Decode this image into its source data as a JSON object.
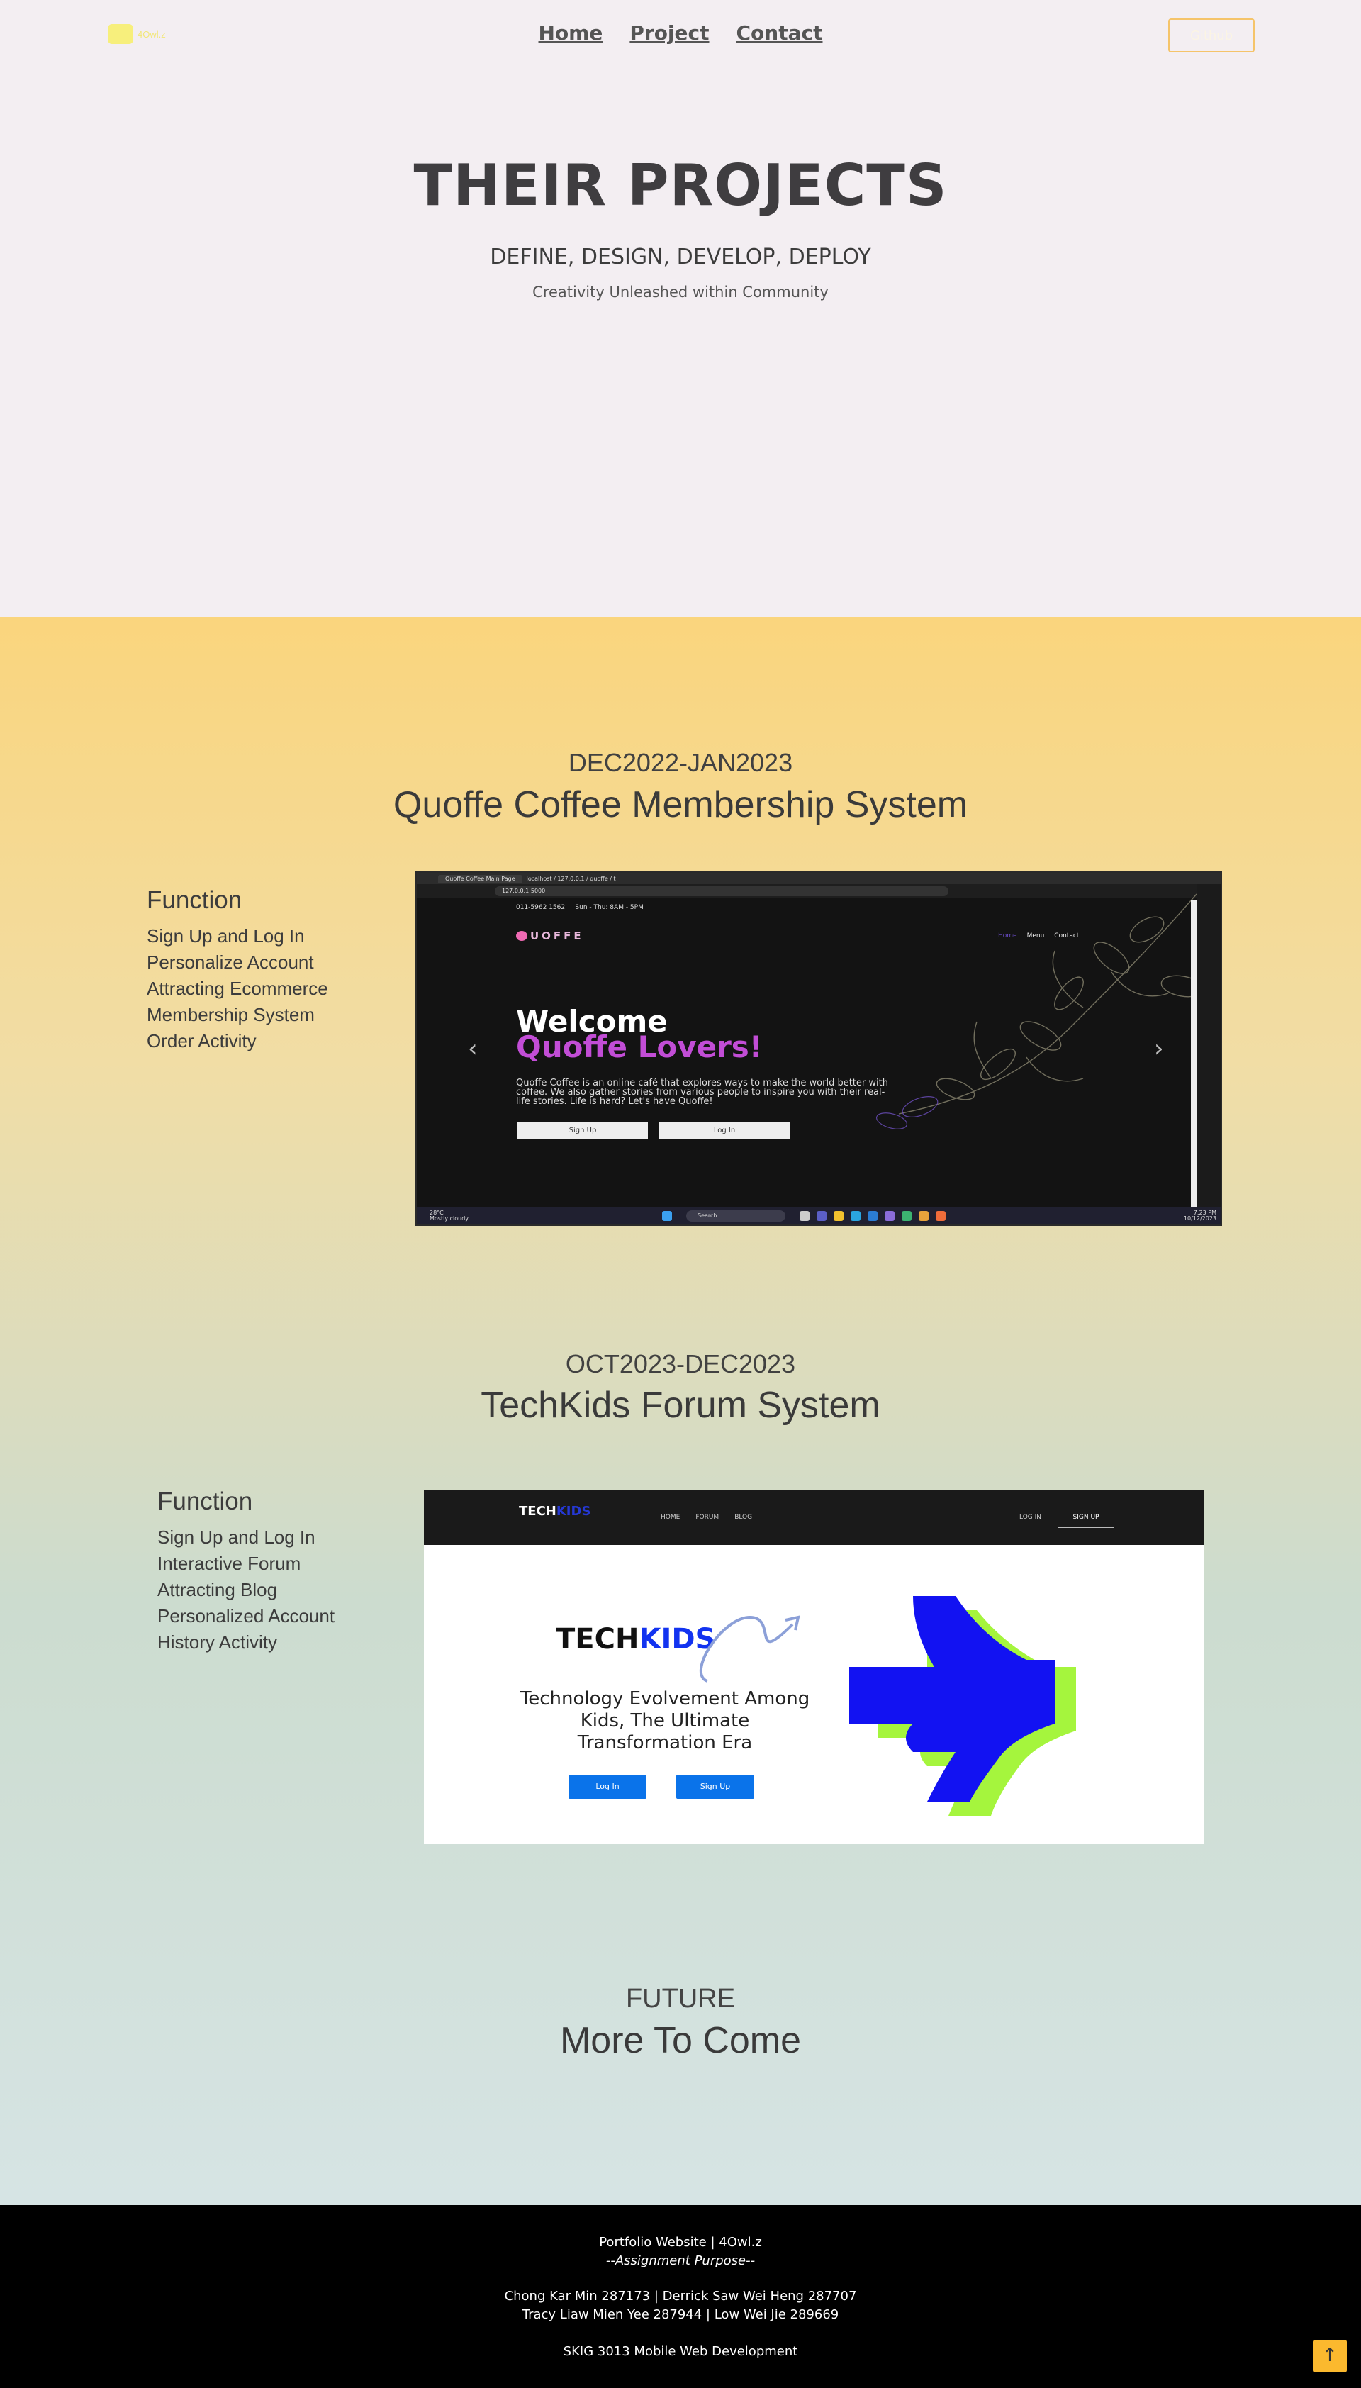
{
  "nav": {
    "logo_text": "4Owl.z",
    "links": [
      "Home",
      "Project",
      "Contact"
    ],
    "github_label": "Github"
  },
  "hero": {
    "title": "THEIR PROJECTS",
    "subtitle": "DEFINE, DESIGN, DEVELOP, DEPLOY",
    "tagline": "Creativity Unleashed within Community"
  },
  "projects": [
    {
      "date": "DEC2022-JAN2023",
      "title": "Quoffe Coffee Membership System",
      "function_heading": "Function",
      "functions": [
        "Sign Up and Log In",
        "Personalize Account",
        "Attracting Ecommerce",
        "Membership System",
        "Order Activity"
      ],
      "screenshot": {
        "tab1": "Quoffe Coffee Main Page",
        "tab2": "localhost / 127.0.0.1 / quoffe / t",
        "address": "127.0.0.1:5000",
        "phone": "011-5962 1562",
        "hours": "Sun - Thu: 8AM - 5PM",
        "logo": "UOFFE",
        "nav": [
          "Home",
          "Menu",
          "Contact"
        ],
        "welcome": "Welcome",
        "lovers": "Quoffe Lovers!",
        "description": "Quoffe Coffee is an online café that explores ways to make the world better with coffee. We also gather stories from various people to inspire you with their real-life stories. Life is hard? Let's have Quoffe!",
        "signup": "Sign Up",
        "login": "Log In",
        "weather_temp": "28°C",
        "weather_desc": "Mostly cloudy",
        "search": "Search",
        "time": "7:23 PM",
        "date": "10/12/2023"
      }
    },
    {
      "date": "OCT2023-DEC2023",
      "title": "TechKids Forum System",
      "function_heading": "Function",
      "functions": [
        "Sign Up and Log In",
        "Interactive Forum",
        "Attracting Blog",
        "Personalized Account",
        "History Activity"
      ],
      "screenshot": {
        "brand_tech": "TECH",
        "brand_kids": "KIDS",
        "nav": [
          "HOME",
          "FORUM",
          "BLOG"
        ],
        "login": "LOG IN",
        "signup": "SIGN UP",
        "tagline": "Technology Evolvement Among Kids, The Ultimate Transformation Era",
        "btn_login": "Log In",
        "btn_signup": "Sign Up"
      }
    }
  ],
  "future": {
    "label": "FUTURE",
    "title": "More To Come"
  },
  "footer": {
    "site": "Portfolio Website | 4Owl.z",
    "assignment": "--Assignment Purpose--",
    "members_1": "Chong Kar Min 287173 | Derrick Saw Wei Heng 287707",
    "members_2": "Tracy Liaw Mien Yee 287944 | Low Wei Jie 289669",
    "course": "SKIG 3013 Mobile Web Development",
    "top_icon": "arrow-up-icon"
  },
  "colors": {
    "accent": "#fbb92e",
    "band_top": "#fad57d",
    "band_bottom": "#d6e4e4",
    "footer_bg": "#000000"
  }
}
